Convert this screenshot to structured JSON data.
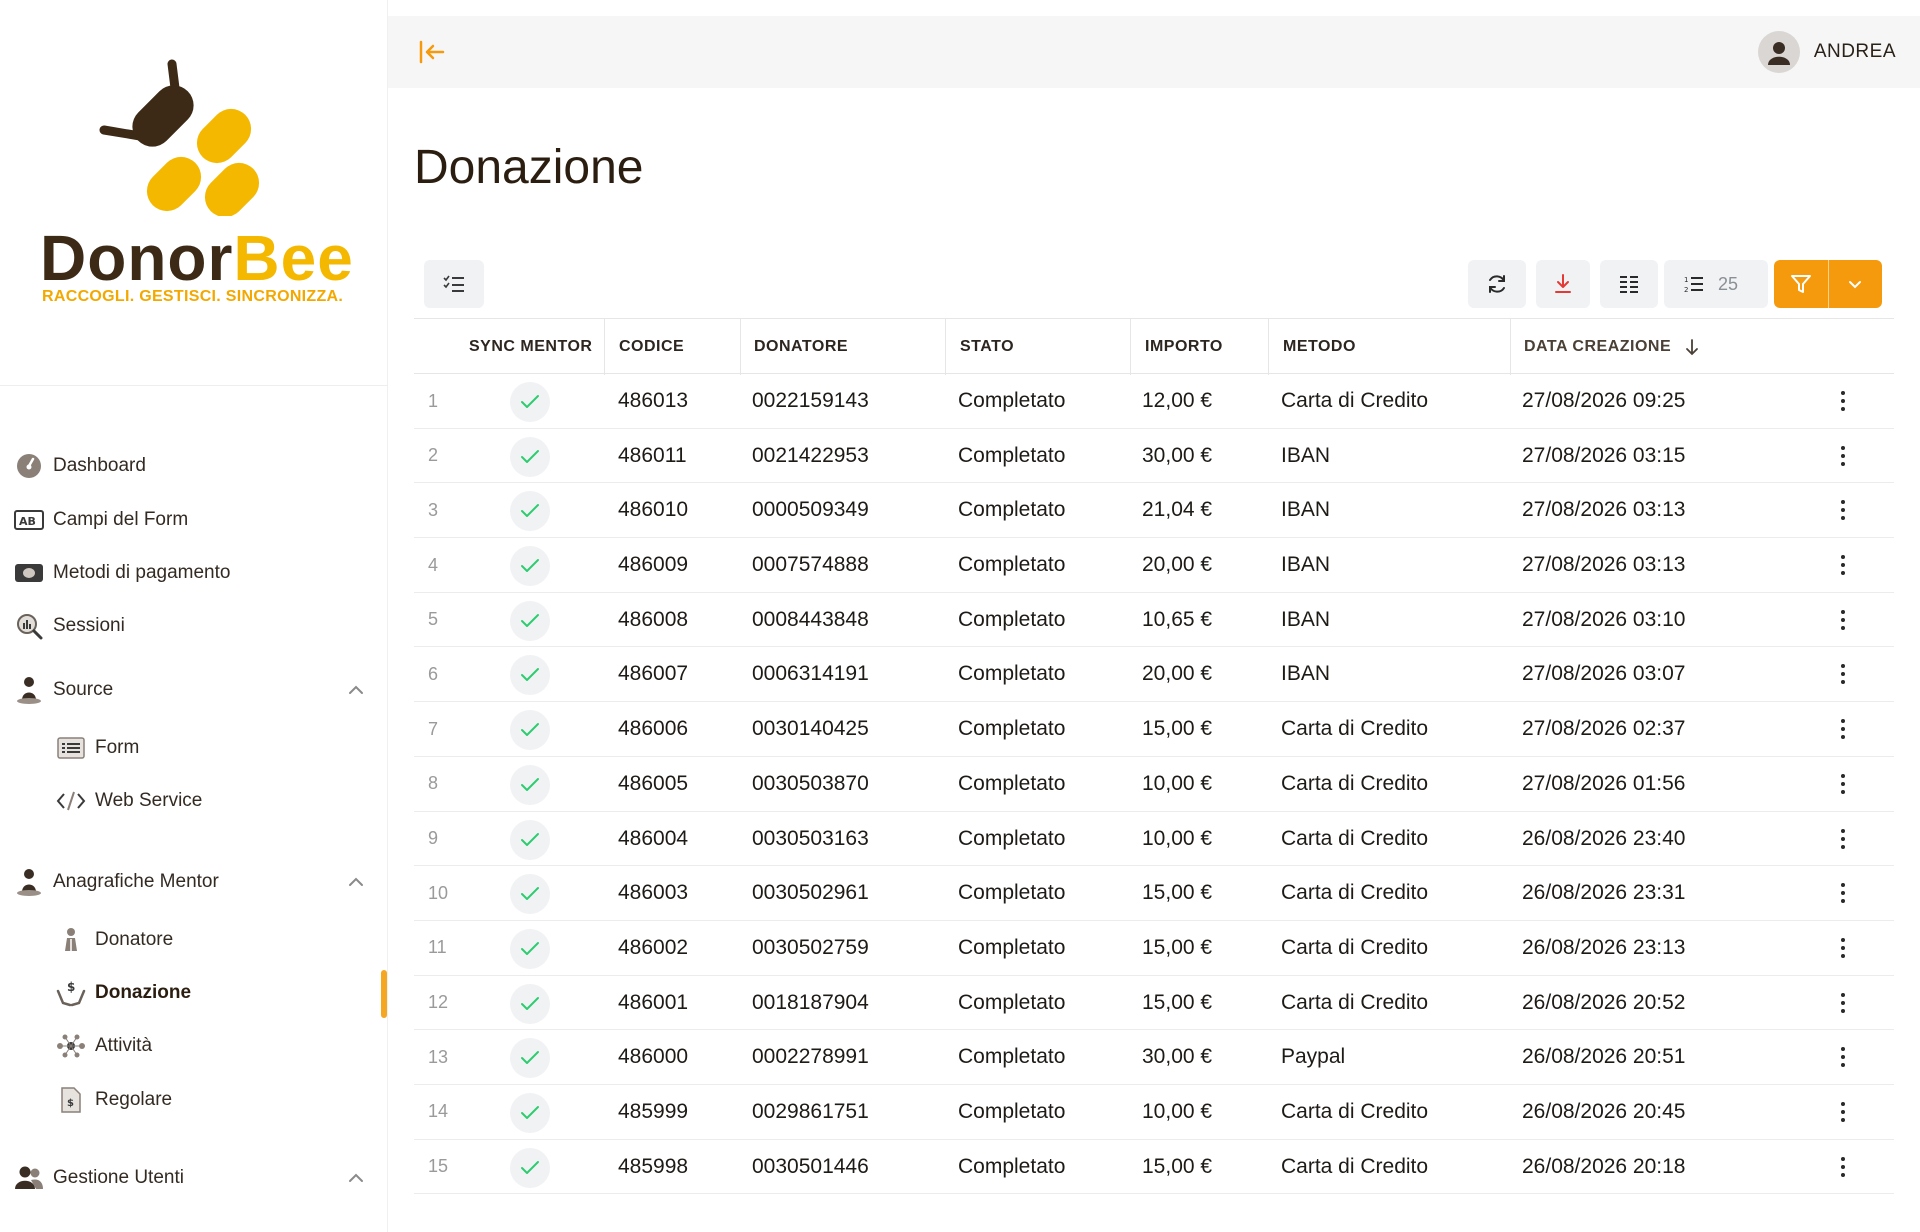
{
  "brand": {
    "name_dark": "Donor",
    "name_gold": "Bee",
    "tagline": "RACCOGLI. GESTISCI. SINCRONIZZA."
  },
  "colors": {
    "accent": "#f59a0d",
    "brand_dark": "#3c2a16",
    "brand_gold": "#f5b800",
    "success": "#2ecc71"
  },
  "sidebar": {
    "items": [
      {
        "label": "Dashboard",
        "icon": "gauge-icon"
      },
      {
        "label": "Campi del Form",
        "icon": "ab-field-icon"
      },
      {
        "label": "Metodi di pagamento",
        "icon": "banknote-icon"
      },
      {
        "label": "Sessioni",
        "icon": "analytics-search-icon"
      }
    ],
    "groups": [
      {
        "label": "Source",
        "icon": "person-icon",
        "expanded": true,
        "children": [
          {
            "label": "Form",
            "icon": "form-list-icon"
          },
          {
            "label": "Web Service",
            "icon": "code-icon"
          }
        ]
      },
      {
        "label": "Anagrafiche Mentor",
        "icon": "person-icon",
        "expanded": true,
        "children": [
          {
            "label": "Donatore",
            "icon": "donor-icon"
          },
          {
            "label": "Donazione",
            "icon": "donation-hand-icon",
            "active": true
          },
          {
            "label": "Attività",
            "icon": "network-icon"
          },
          {
            "label": "Regolare",
            "icon": "document-dollar-icon"
          }
        ]
      },
      {
        "label": "Gestione Utenti",
        "icon": "users-icon",
        "expanded": true,
        "children": []
      }
    ]
  },
  "topbar": {
    "username": "ANDREA"
  },
  "page": {
    "title": "Donazione"
  },
  "toolbar": {
    "rows_per_page": "25"
  },
  "table": {
    "columns": [
      "SYNC MENTOR",
      "CODICE",
      "DONATORE",
      "STATO",
      "IMPORTO",
      "METODO",
      "DATA CREAZIONE"
    ],
    "sorted_column": "DATA CREAZIONE",
    "sort_direction": "desc",
    "rows": [
      {
        "n": "1",
        "codice": "486013",
        "donatore": "0022159143",
        "stato": "Completato",
        "importo": "12,00 €",
        "metodo": "Carta di Credito",
        "data": "27/08/2026 09:25"
      },
      {
        "n": "2",
        "codice": "486011",
        "donatore": "0021422953",
        "stato": "Completato",
        "importo": "30,00 €",
        "metodo": "IBAN",
        "data": "27/08/2026 03:15"
      },
      {
        "n": "3",
        "codice": "486010",
        "donatore": "0000509349",
        "stato": "Completato",
        "importo": "21,04 €",
        "metodo": "IBAN",
        "data": "27/08/2026 03:13"
      },
      {
        "n": "4",
        "codice": "486009",
        "donatore": "0007574888",
        "stato": "Completato",
        "importo": "20,00 €",
        "metodo": "IBAN",
        "data": "27/08/2026 03:13"
      },
      {
        "n": "5",
        "codice": "486008",
        "donatore": "0008443848",
        "stato": "Completato",
        "importo": "10,65 €",
        "metodo": "IBAN",
        "data": "27/08/2026 03:10"
      },
      {
        "n": "6",
        "codice": "486007",
        "donatore": "0006314191",
        "stato": "Completato",
        "importo": "20,00 €",
        "metodo": "IBAN",
        "data": "27/08/2026 03:07"
      },
      {
        "n": "7",
        "codice": "486006",
        "donatore": "0030140425",
        "stato": "Completato",
        "importo": "15,00 €",
        "metodo": "Carta di Credito",
        "data": "27/08/2026 02:37"
      },
      {
        "n": "8",
        "codice": "486005",
        "donatore": "0030503870",
        "stato": "Completato",
        "importo": "10,00 €",
        "metodo": "Carta di Credito",
        "data": "27/08/2026 01:56"
      },
      {
        "n": "9",
        "codice": "486004",
        "donatore": "0030503163",
        "stato": "Completato",
        "importo": "10,00 €",
        "metodo": "Carta di Credito",
        "data": "26/08/2026 23:40"
      },
      {
        "n": "10",
        "codice": "486003",
        "donatore": "0030502961",
        "stato": "Completato",
        "importo": "15,00 €",
        "metodo": "Carta di Credito",
        "data": "26/08/2026 23:31"
      },
      {
        "n": "11",
        "codice": "486002",
        "donatore": "0030502759",
        "stato": "Completato",
        "importo": "15,00 €",
        "metodo": "Carta di Credito",
        "data": "26/08/2026 23:13"
      },
      {
        "n": "12",
        "codice": "486001",
        "donatore": "0018187904",
        "stato": "Completato",
        "importo": "15,00 €",
        "metodo": "Carta di Credito",
        "data": "26/08/2026 20:52"
      },
      {
        "n": "13",
        "codice": "486000",
        "donatore": "0002278991",
        "stato": "Completato",
        "importo": "30,00 €",
        "metodo": "Paypal",
        "data": "26/08/2026 20:51"
      },
      {
        "n": "14",
        "codice": "485999",
        "donatore": "0029861751",
        "stato": "Completato",
        "importo": "10,00 €",
        "metodo": "Carta di Credito",
        "data": "26/08/2026 20:45"
      },
      {
        "n": "15",
        "codice": "485998",
        "donatore": "0030501446",
        "stato": "Completato",
        "importo": "15,00 €",
        "metodo": "Carta di Credito",
        "data": "26/08/2026 20:18"
      }
    ]
  }
}
